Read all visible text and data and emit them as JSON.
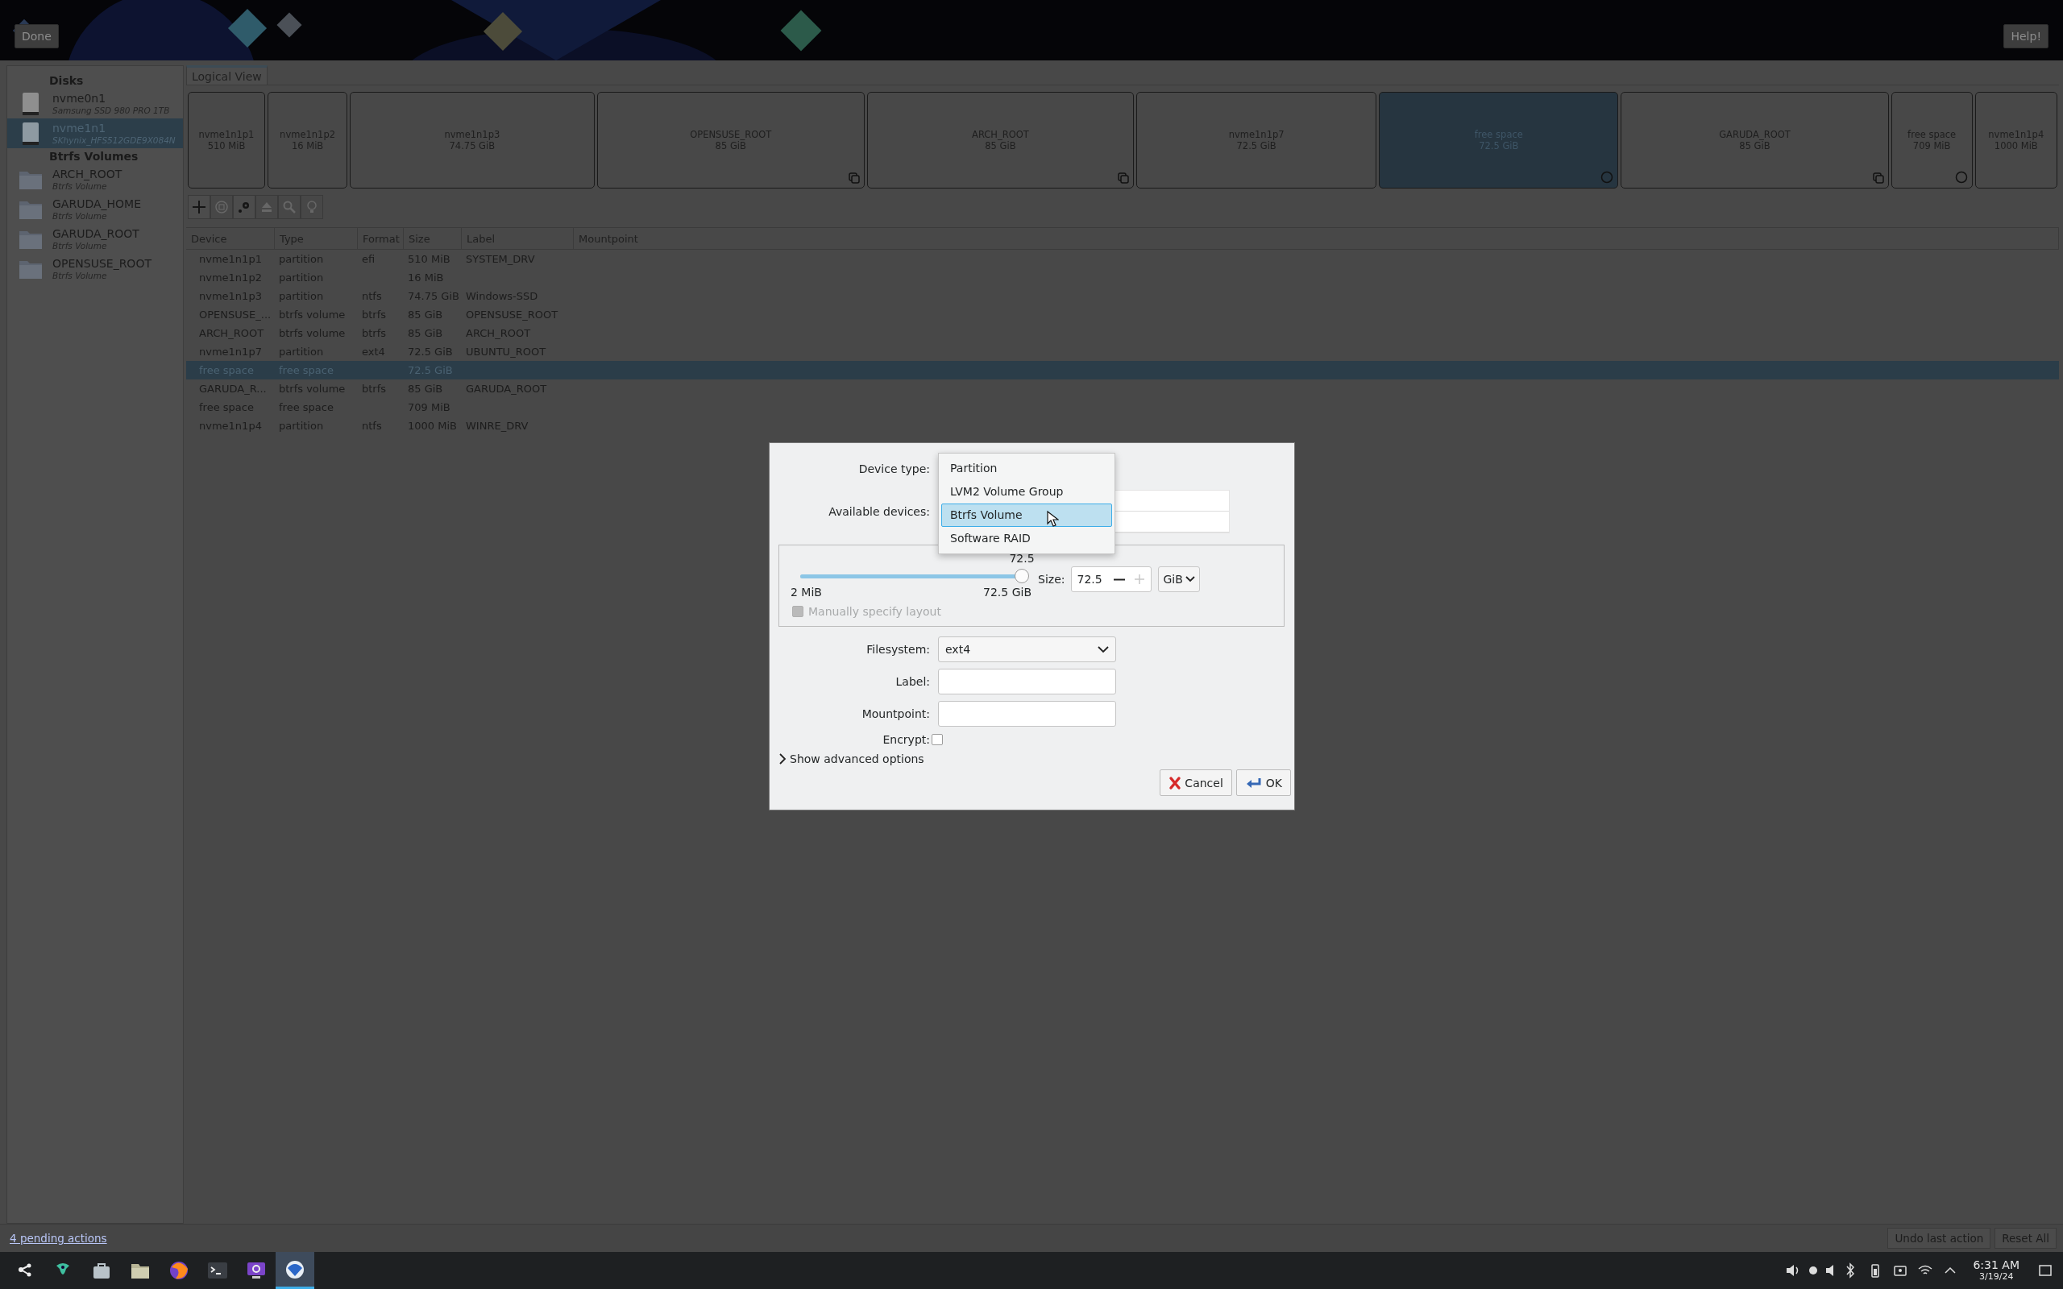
{
  "top_bar": {
    "done_button": "Done",
    "help_button": "Help!"
  },
  "sidebar": {
    "sections": [
      {
        "title": "Disks",
        "items": [
          {
            "name": "nvme0n1",
            "subtitle": "Samsung SSD 980 PRO 1TB",
            "kind": "disk",
            "selected": false
          },
          {
            "name": "nvme1n1",
            "subtitle": "SKhynix_HFS512GDE9X084N",
            "kind": "disk",
            "selected": true
          }
        ]
      },
      {
        "title": "Btrfs Volumes",
        "items": [
          {
            "name": "ARCH_ROOT",
            "subtitle": "Btrfs Volume",
            "kind": "folder",
            "selected": false
          },
          {
            "name": "GARUDA_HOME",
            "subtitle": "Btrfs Volume",
            "kind": "folder",
            "selected": false
          },
          {
            "name": "GARUDA_ROOT",
            "subtitle": "Btrfs Volume",
            "kind": "folder",
            "selected": false
          },
          {
            "name": "OPENSUSE_ROOT",
            "subtitle": "Btrfs Volume",
            "kind": "folder",
            "selected": false
          }
        ]
      }
    ]
  },
  "view_tabs": [
    {
      "label": "Logical View",
      "selected": true
    }
  ],
  "partitions": [
    {
      "name": "nvme1n1p1",
      "size": "510 MiB",
      "kind": "partition",
      "selected": false
    },
    {
      "name": "nvme1n1p2",
      "size": "16 MiB",
      "kind": "partition",
      "selected": false
    },
    {
      "name": "nvme1n1p3",
      "size": "74.75 GiB",
      "kind": "partition",
      "selected": false
    },
    {
      "name": "OPENSUSE_ROOT",
      "size": "85 GiB",
      "kind": "btrfs",
      "selected": false
    },
    {
      "name": "ARCH_ROOT",
      "size": "85 GiB",
      "kind": "btrfs",
      "selected": false
    },
    {
      "name": "nvme1n1p7",
      "size": "72.5 GiB",
      "kind": "partition",
      "selected": false
    },
    {
      "name": "free space",
      "size": "72.5 GiB",
      "kind": "free",
      "selected": true
    },
    {
      "name": "GARUDA_ROOT",
      "size": "85 GiB",
      "kind": "btrfs",
      "selected": false
    },
    {
      "name": "free space",
      "size": "709 MiB",
      "kind": "free",
      "selected": false
    },
    {
      "name": "nvme1n1p4",
      "size": "1000 MiB",
      "kind": "partition",
      "selected": false
    }
  ],
  "toolbar": [
    {
      "kind": "add",
      "disabled": false
    },
    {
      "kind": "delete",
      "disabled": true
    },
    {
      "kind": "configure",
      "disabled": false
    },
    {
      "kind": "unmount",
      "disabled": true
    },
    {
      "kind": "info",
      "disabled": true
    },
    {
      "kind": "light",
      "disabled": true
    }
  ],
  "table": {
    "columns": [
      "Device",
      "Type",
      "Format",
      "Size",
      "Label",
      "Mountpoint"
    ],
    "rows": [
      {
        "device": "nvme1n1p1",
        "type": "partition",
        "format": "efi",
        "size": "510 MiB",
        "label": "SYSTEM_DRV",
        "selected": false
      },
      {
        "device": "nvme1n1p2",
        "type": "partition",
        "size": "16 MiB",
        "selected": false
      },
      {
        "device": "nvme1n1p3",
        "type": "partition",
        "format": "ntfs",
        "size": "74.75 GiB",
        "label": "Windows-SSD",
        "selected": false
      },
      {
        "device": "OPENSUSE_...",
        "type": "btrfs volume",
        "format": "btrfs",
        "size": "85 GiB",
        "label": "OPENSUSE_ROOT",
        "selected": false
      },
      {
        "device": "ARCH_ROOT",
        "type": "btrfs volume",
        "format": "btrfs",
        "size": "85 GiB",
        "label": "ARCH_ROOT",
        "selected": false
      },
      {
        "device": "nvme1n1p7",
        "type": "partition",
        "format": "ext4",
        "size": "72.5 GiB",
        "label": "UBUNTU_ROOT",
        "selected": false
      },
      {
        "device": "free space",
        "type": "free space",
        "size": "72.5 GiB",
        "selected": true
      },
      {
        "device": "GARUDA_R...",
        "type": "btrfs volume",
        "format": "btrfs",
        "size": "85 GiB",
        "label": "GARUDA_ROOT",
        "selected": false
      },
      {
        "device": "free space",
        "type": "free space",
        "size": "709 MiB",
        "selected": false
      },
      {
        "device": "nvme1n1p4",
        "type": "partition",
        "format": "ntfs",
        "size": "1000 MiB",
        "label": "WINRE_DRV",
        "selected": false
      }
    ]
  },
  "dialog": {
    "device_type_label": "Device type:",
    "available_devices_label": "Available devices:",
    "device_type_menu": [
      {
        "label": "Partition",
        "selected": false
      },
      {
        "label": "LVM2 Volume Group",
        "selected": false
      },
      {
        "label": "Btrfs Volume",
        "selected": true
      },
      {
        "label": "Software RAID",
        "selected": false
      }
    ],
    "size": {
      "level": 1,
      "reading": "72.5",
      "min_label": "2 MiB",
      "max_label": "72.5 GiB",
      "size_label": "Size:",
      "size_value": "72.5",
      "unit": "GiB"
    },
    "manual_layout": {
      "label": "Manually specify layout",
      "checked": false,
      "disabled": true
    },
    "fields": [
      {
        "label": "Filesystem:",
        "kind": "combo",
        "value": "ext4"
      },
      {
        "label": "Label:",
        "kind": "text"
      },
      {
        "label": "Mountpoint:",
        "kind": "text"
      }
    ],
    "encrypt": {
      "label": "Encrypt:",
      "checked": false
    },
    "advanced": {
      "label": "Show advanced options",
      "expanded": false
    },
    "buttons": [
      {
        "label": "Cancel",
        "kind": "cancel"
      },
      {
        "label": "OK",
        "kind": "ok"
      }
    ]
  },
  "status_bar": {
    "pending_link": "4 pending actions",
    "buttons": [
      "Undo last action",
      "Reset All"
    ]
  },
  "taskbar": {
    "apps": [
      {
        "kind": "launcher",
        "active": false
      },
      {
        "kind": "garuda",
        "active": false
      },
      {
        "kind": "store",
        "active": false
      },
      {
        "kind": "files",
        "active": false
      },
      {
        "kind": "browser",
        "active": false
      },
      {
        "kind": "terminal",
        "active": false
      },
      {
        "kind": "monitor",
        "active": false
      },
      {
        "kind": "installer",
        "active": true
      }
    ],
    "clock": {
      "time": "6:31 AM",
      "date": "3/19/24"
    }
  }
}
